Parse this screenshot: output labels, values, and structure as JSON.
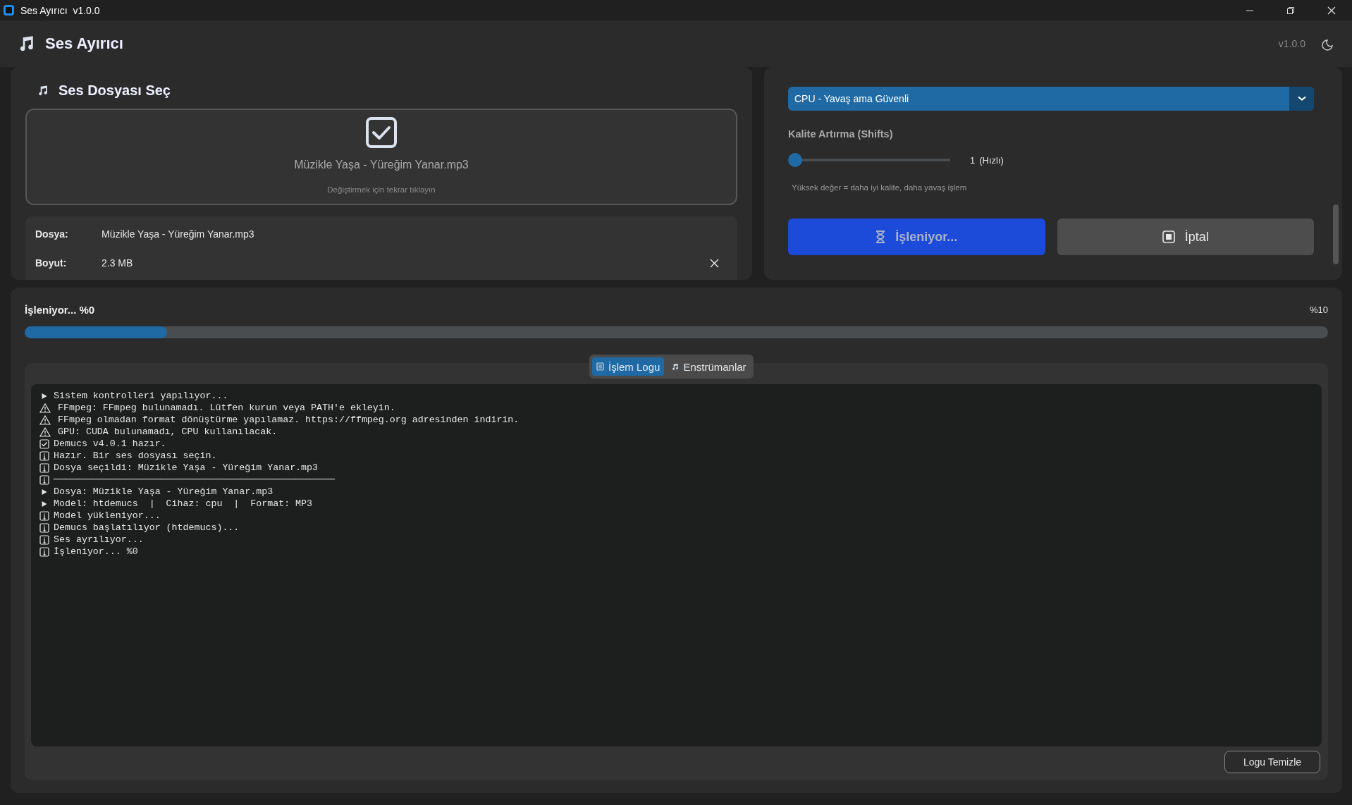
{
  "titlebar": {
    "title": "Ses Ayırıcı  v1.0.0"
  },
  "header": {
    "title": "Ses Ayırıcı",
    "version": "v1.0.0"
  },
  "file_panel": {
    "title": "Ses Dosyası Seç",
    "drop_zone": {
      "file_name": "Müzikle Yaşa - Yüreğim Yanar.mp3",
      "hint": "Değiştirmek için tekrar tıklayın"
    },
    "info": [
      {
        "label": "Dosya:",
        "value": "Müzikle Yaşa - Yüreğim Yanar.mp3"
      },
      {
        "label": "Boyut:",
        "value": "2.3 MB"
      }
    ]
  },
  "settings": {
    "device_select": {
      "value": "CPU - Yavaş ama Güvenli"
    },
    "shifts": {
      "label": "Kalite Artırma (Shifts)",
      "level": 0,
      "value": "1",
      "note": "(Hızlı)",
      "hint": "Yüksek değer = daha iyi kalite, daha yavaş işlem"
    },
    "buttons": [
      {
        "label": "İşleniyor...",
        "kind": "process"
      },
      {
        "label": "İptal",
        "kind": "cancel"
      }
    ]
  },
  "progress": {
    "label": "İşleniyor... %0",
    "percent": "%10",
    "level": 0.109
  },
  "tabs": [
    {
      "label": "İşlem Logu",
      "selected": true,
      "kind": "log"
    },
    {
      "label": "Enstrümanlar",
      "selected": false,
      "kind": "music"
    }
  ],
  "log": [
    {
      "kind": "arrow",
      "text": "Sistem kontrolleri yapılıyor..."
    },
    {
      "kind": "warning",
      "text": "FFmpeg: FFmpeg bulunamadı. Lütfen kurun veya PATH'e ekleyin."
    },
    {
      "kind": "warning",
      "text": "FFmpeg olmadan format dönüştürme yapılamaz. https://ffmpeg.org adresinden indirin."
    },
    {
      "kind": "warning",
      "text": "GPU: CUDA bulunamadı, CPU kullanılacak."
    },
    {
      "kind": "check",
      "text": "Demucs v4.0.1 hazır."
    },
    {
      "kind": "info",
      "text": "Hazır. Bir ses dosyası seçin."
    },
    {
      "kind": "info",
      "text": "Dosya seçildi: Müzikle Yaşa - Yüreğim Yanar.mp3"
    },
    {
      "kind": "info",
      "text": "──────────────────────────────────────────────────"
    },
    {
      "kind": "arrow",
      "text": "Dosya: Müzikle Yaşa - Yüreğim Yanar.mp3"
    },
    {
      "kind": "arrow",
      "text": "Model: htdemucs  |  Cihaz: cpu  |  Format: MP3"
    },
    {
      "kind": "info",
      "text": "Model yükleniyor..."
    },
    {
      "kind": "info",
      "text": "Demucs başlatılıyor (htdemucs)..."
    },
    {
      "kind": "info",
      "text": "Ses ayrılıyor..."
    },
    {
      "kind": "info",
      "text": "İşleniyor... %0"
    }
  ],
  "clear_button": "Logu Temizle"
}
